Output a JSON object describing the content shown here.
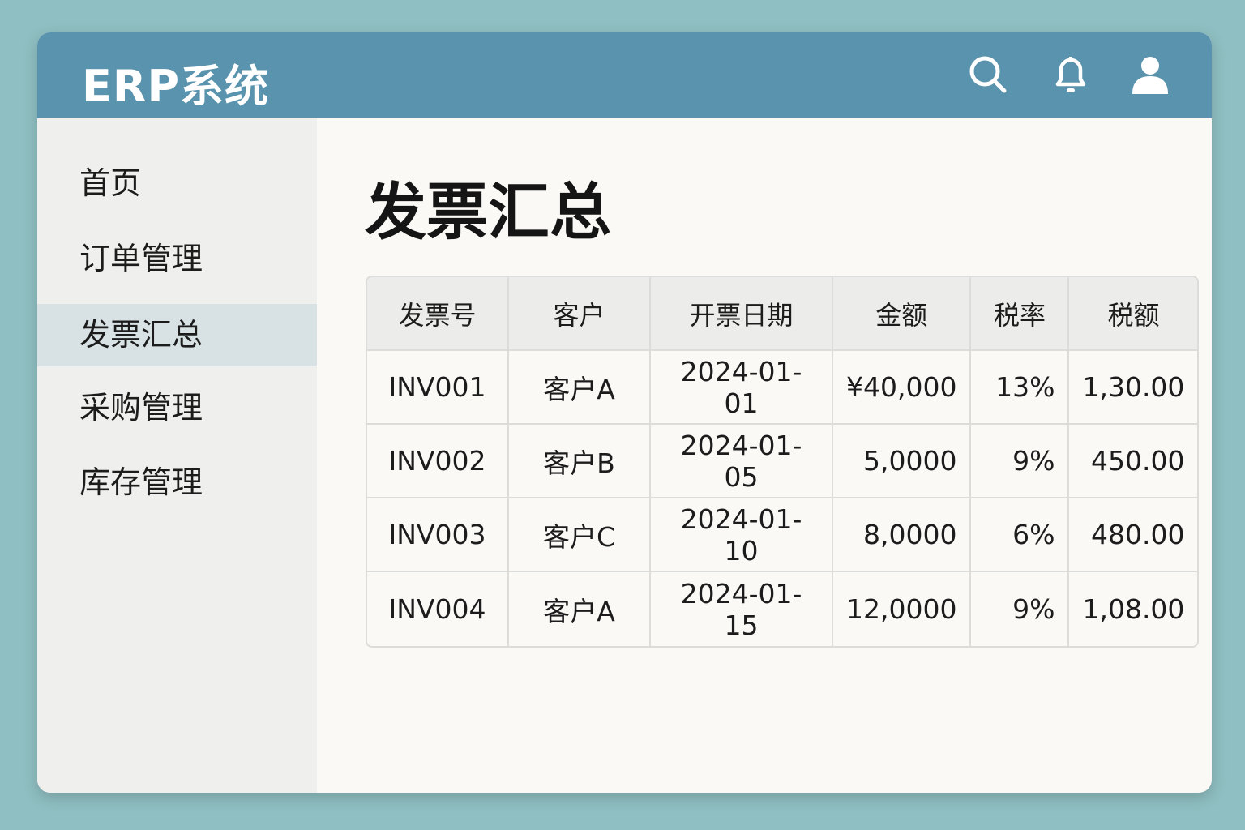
{
  "app": {
    "title": "ERP系统"
  },
  "header": {
    "icons": [
      "search-icon",
      "bell-icon",
      "user-icon"
    ]
  },
  "sidebar": {
    "items": [
      {
        "label": "首页"
      },
      {
        "label": "订单管理"
      },
      {
        "label": "发票汇总",
        "active": true
      },
      {
        "label": "采购管理"
      },
      {
        "label": "库存管理"
      }
    ]
  },
  "main": {
    "title": "发票汇总",
    "table": {
      "headers": [
        "发票号",
        "客户",
        "开票日期",
        "金额",
        "税率",
        "税额"
      ],
      "rows": [
        [
          "INV001",
          "客户A",
          "2024-01-01",
          "¥40,000",
          "13%",
          "1,30.00"
        ],
        [
          "INV002",
          "客户B",
          "2024-01-05",
          "5,0000",
          "9%",
          "450.00"
        ],
        [
          "INV003",
          "客户C",
          "2024-01-10",
          "8,0000",
          "6%",
          "480.00"
        ],
        [
          "INV004",
          "客户A",
          "2024-01-15",
          "12,0000",
          "9%",
          "1,08.00"
        ]
      ]
    }
  },
  "colors": {
    "header": "#5a93ad",
    "background": "#8fbfc2",
    "active": "#d8e1e4"
  }
}
